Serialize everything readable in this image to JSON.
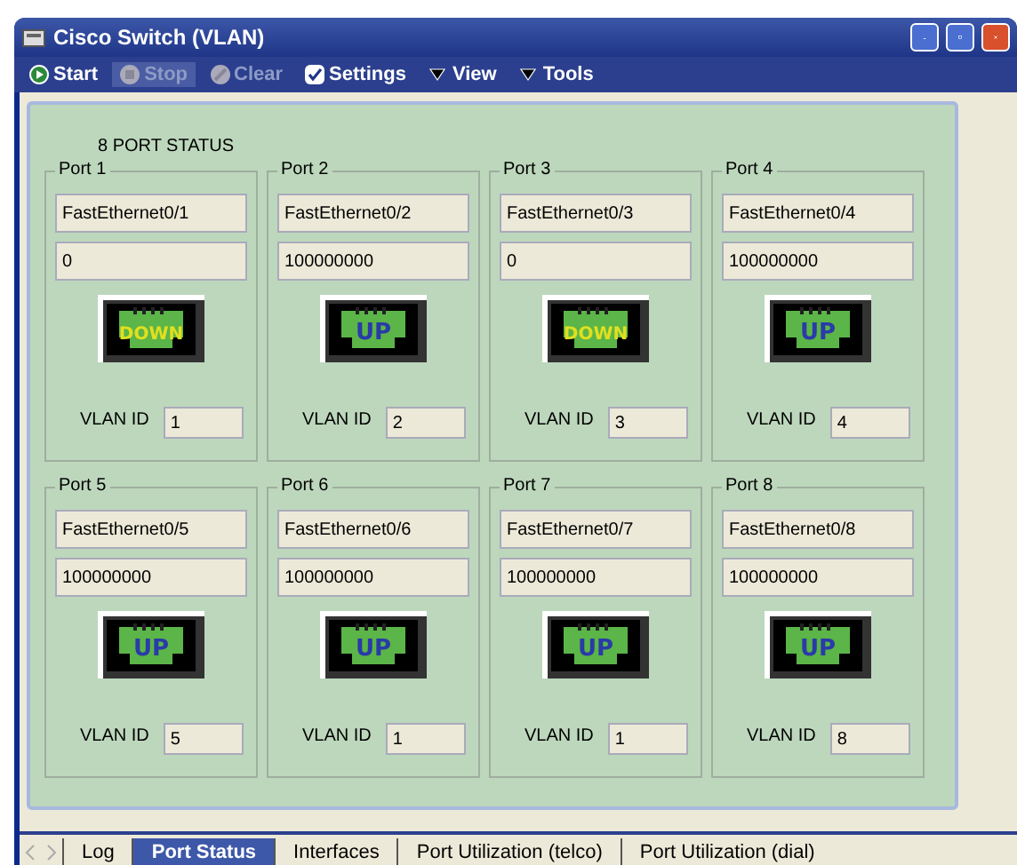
{
  "window": {
    "title": "Cisco Switch (VLAN)"
  },
  "toolbar": [
    {
      "kind": "start",
      "label": "Start",
      "disabled": false,
      "selected": false
    },
    {
      "kind": "stop",
      "label": "Stop",
      "disabled": true,
      "selected": true
    },
    {
      "kind": "clear",
      "label": "Clear",
      "disabled": true,
      "selected": false
    },
    {
      "kind": "settings",
      "label": "Settings",
      "disabled": false,
      "selected": false
    },
    {
      "kind": "menu",
      "label": "View",
      "disabled": false,
      "selected": false
    },
    {
      "kind": "menu",
      "label": "Tools",
      "disabled": false,
      "selected": false
    }
  ],
  "heading": "8 PORT STATUS",
  "ports": [
    {
      "title": "Port 1",
      "interface": "FastEthernet0/1",
      "speed": "0",
      "link": {
        "kind": "down",
        "label": "DOWN"
      },
      "vlan_label": "VLAN ID",
      "vlan_id": "1"
    },
    {
      "title": "Port 2",
      "interface": "FastEthernet0/2",
      "speed": "100000000",
      "link": {
        "kind": "up",
        "label": "UP"
      },
      "vlan_label": "VLAN ID",
      "vlan_id": "2"
    },
    {
      "title": "Port 3",
      "interface": "FastEthernet0/3",
      "speed": "0",
      "link": {
        "kind": "down",
        "label": "DOWN"
      },
      "vlan_label": "VLAN ID",
      "vlan_id": "3"
    },
    {
      "title": "Port 4",
      "interface": "FastEthernet0/4",
      "speed": "100000000",
      "link": {
        "kind": "up",
        "label": "UP"
      },
      "vlan_label": "VLAN ID",
      "vlan_id": "4"
    },
    {
      "title": "Port 5",
      "interface": "FastEthernet0/5",
      "speed": "100000000",
      "link": {
        "kind": "up",
        "label": "UP"
      },
      "vlan_label": "VLAN ID",
      "vlan_id": "5"
    },
    {
      "title": "Port 6",
      "interface": "FastEthernet0/6",
      "speed": "100000000",
      "link": {
        "kind": "up",
        "label": "UP"
      },
      "vlan_label": "VLAN ID",
      "vlan_id": "1"
    },
    {
      "title": "Port 7",
      "interface": "FastEthernet0/7",
      "speed": "100000000",
      "link": {
        "kind": "up",
        "label": "UP"
      },
      "vlan_label": "VLAN ID",
      "vlan_id": "1"
    },
    {
      "title": "Port 8",
      "interface": "FastEthernet0/8",
      "speed": "100000000",
      "link": {
        "kind": "up",
        "label": "UP"
      },
      "vlan_label": "VLAN ID",
      "vlan_id": "8"
    }
  ],
  "tabs": [
    {
      "label": "Log",
      "selected": false
    },
    {
      "label": "Port Status",
      "selected": true
    },
    {
      "label": "Interfaces",
      "selected": false
    },
    {
      "label": "Port Utilization (telco)",
      "selected": false
    },
    {
      "label": "Port Utilization (dial)",
      "selected": false
    }
  ]
}
